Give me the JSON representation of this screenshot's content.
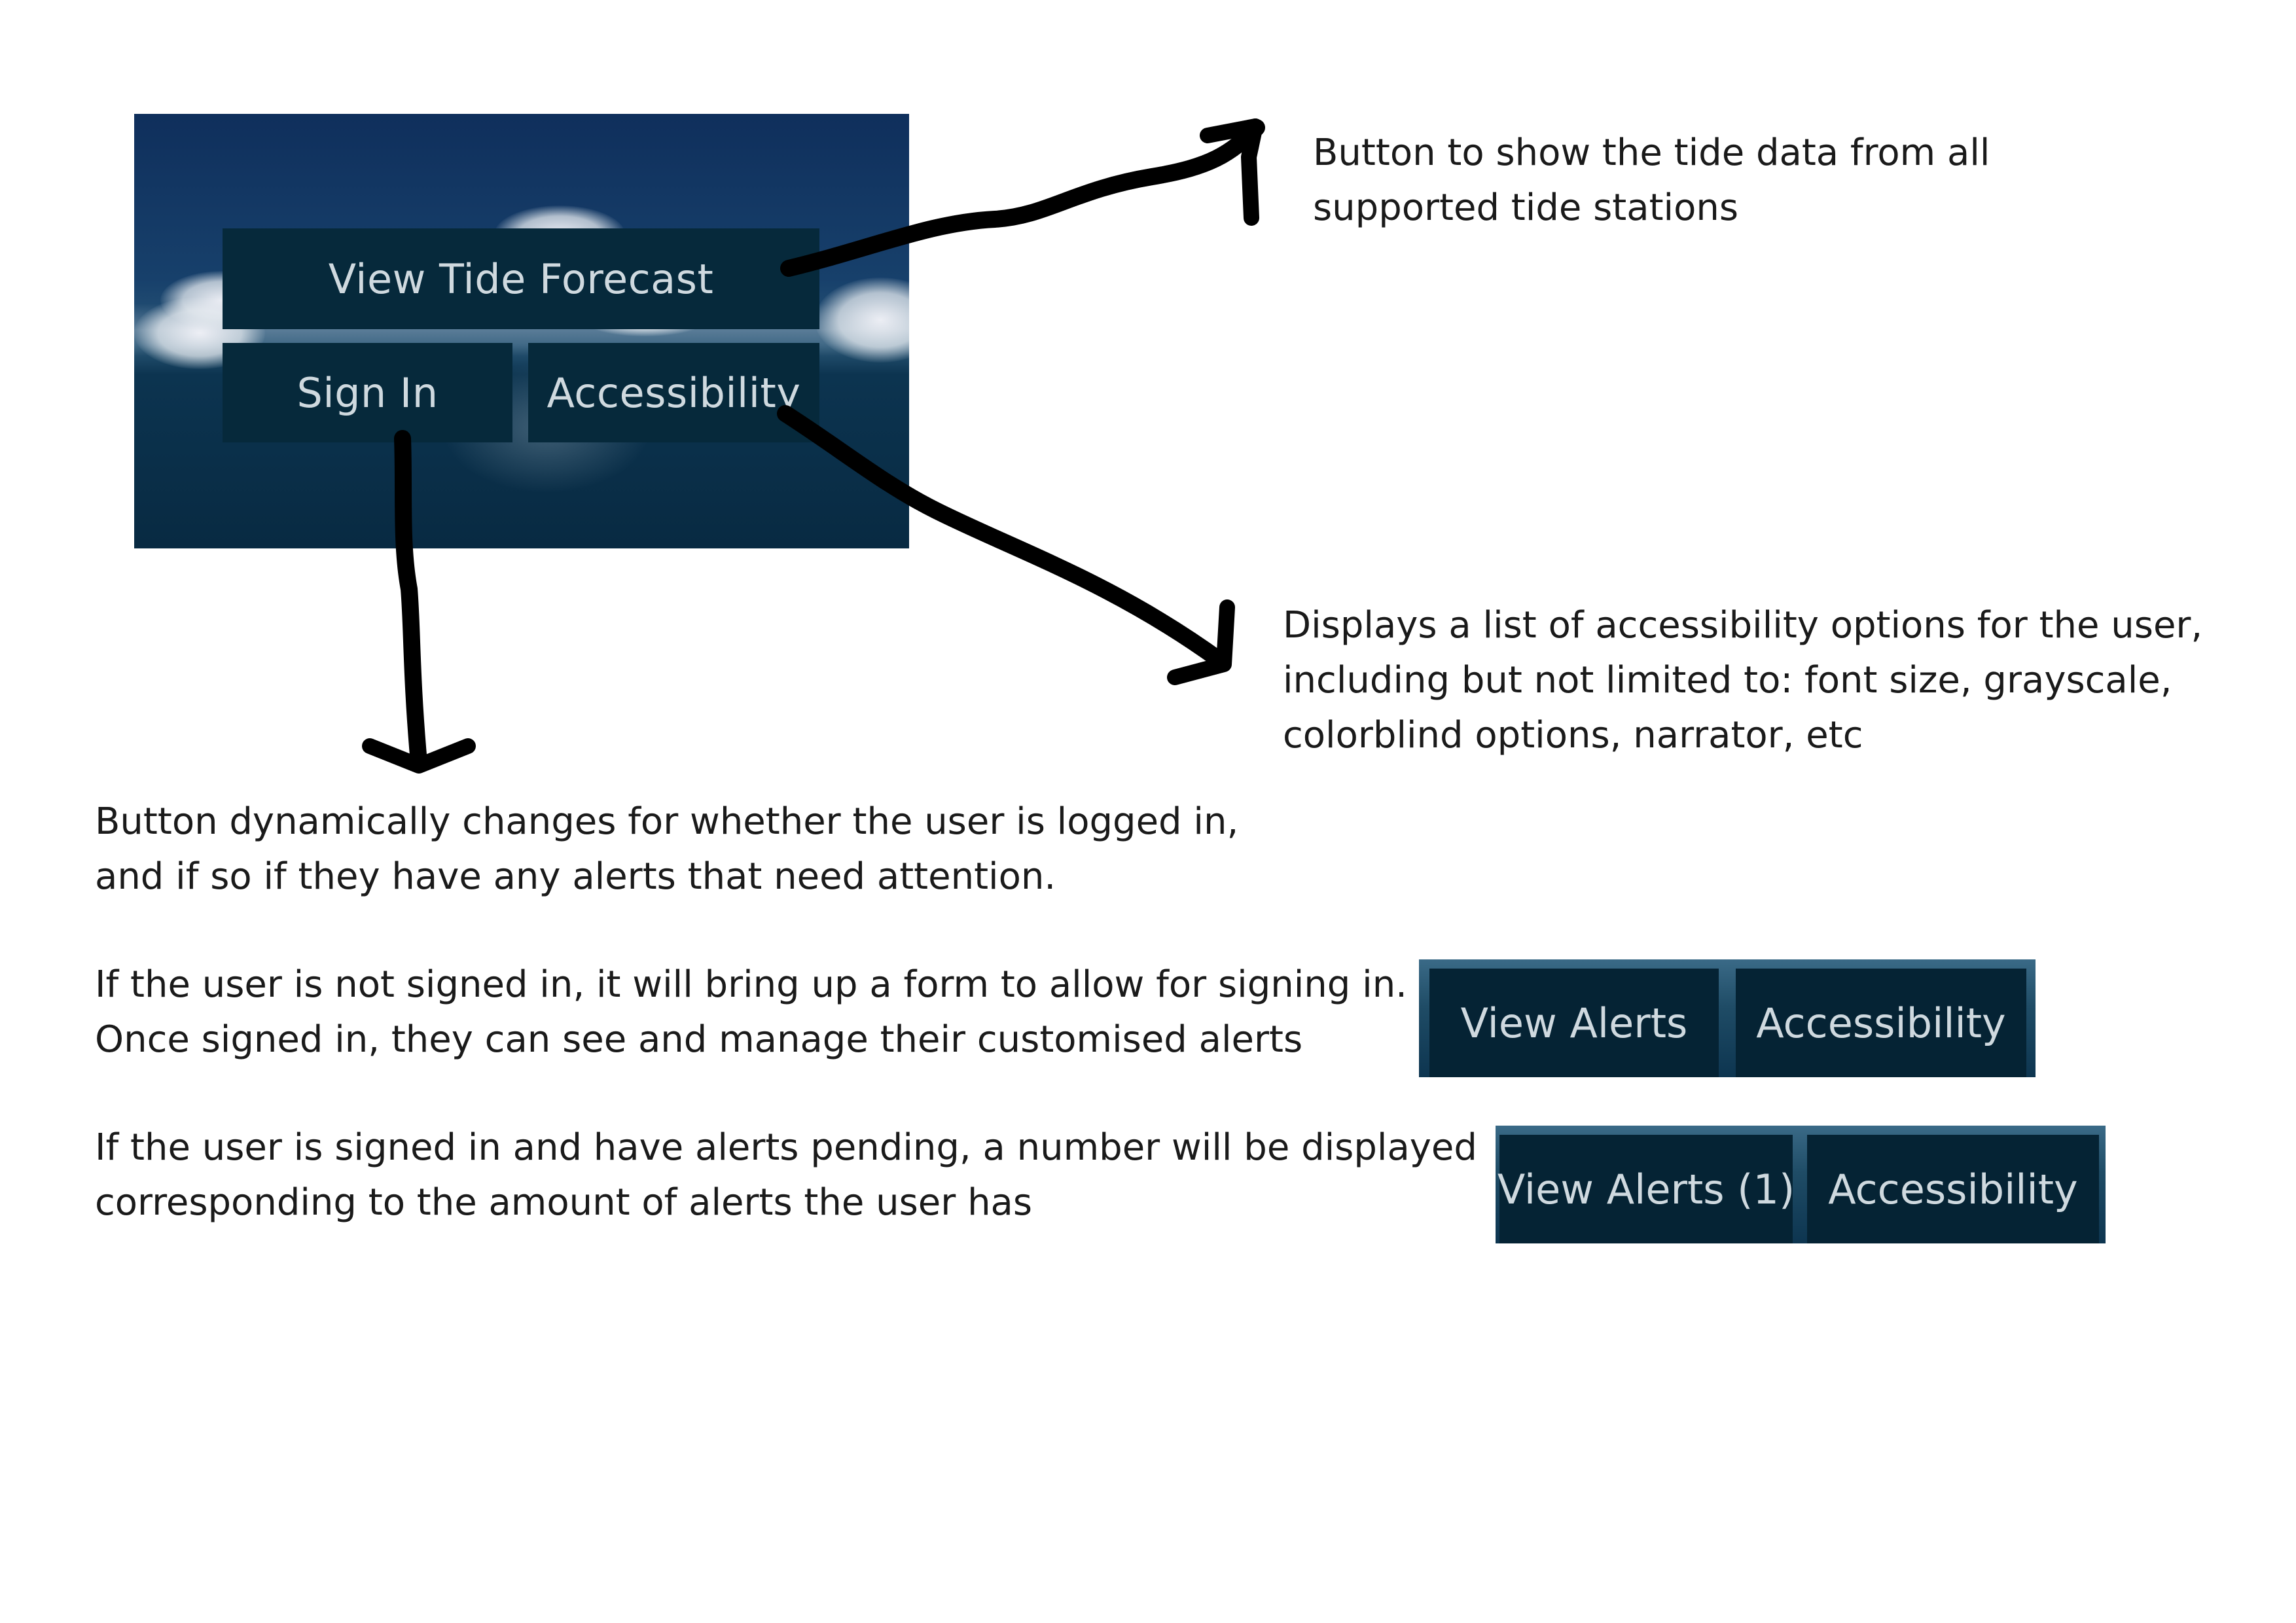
{
  "panel": {
    "view_tide_forecast": "View Tide Forecast",
    "sign_in": "Sign In",
    "accessibility": "Accessibility"
  },
  "strip_signed_in": {
    "view_alerts": "View Alerts",
    "accessibility": "Accessibility"
  },
  "strip_alerts_pending": {
    "view_alerts": "View Alerts (1)",
    "accessibility": "Accessibility"
  },
  "notes": {
    "tide": [
      "Button to show the tide data from all",
      "supported tide stations"
    ],
    "accessibility": [
      "Displays a list of accessibility options for the user,",
      "including but not limited to: font size, grayscale,",
      "colorblind options, narrator, etc"
    ],
    "sign_in": [
      "Button dynamically changes for whether the user is logged in,",
      "and if so if they have any alerts that need attention."
    ],
    "not_signed_in": [
      "If the user is not signed in, it will bring up a form to allow for signing in.",
      "Once signed in, they can see and manage their customised alerts"
    ],
    "alerts_pending": [
      "If the user is signed in and have alerts pending, a number will be displayed",
      "corresponding to the amount of alerts the user has"
    ]
  },
  "icons": [
    "arrow-to-tide-note",
    "arrow-to-accessibility-note",
    "arrow-to-sign-in-note"
  ]
}
